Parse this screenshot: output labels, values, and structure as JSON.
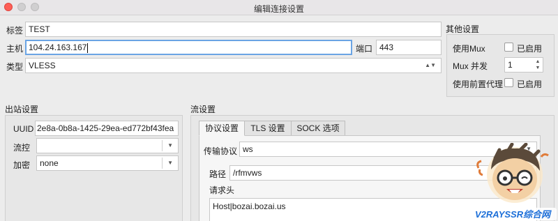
{
  "window": {
    "title": "编辑连接设置"
  },
  "basic": {
    "tag_label": "标签",
    "tag_value": "TEST",
    "host_label": "主机",
    "host_value": "104.24.163.167",
    "port_label": "端口",
    "port_value": "443",
    "type_label": "类型",
    "type_value": "VLESS"
  },
  "other": {
    "title": "其他设置",
    "mux_label": "使用Mux",
    "mux_enable": "已启用",
    "mux_enabled": false,
    "concurrency_label": "Mux 并发",
    "concurrency_value": "1",
    "proxy_label": "使用前置代理",
    "proxy_enable": "已启用",
    "proxy_enabled": false
  },
  "outbound": {
    "title": "出站设置",
    "uuid_label": "UUID",
    "uuid_value": "2e8a-0b8a-1425-29ea-ed772bf43fea",
    "flow_label": "流控",
    "flow_value": "",
    "encryption_label": "加密",
    "encryption_value": "none"
  },
  "stream": {
    "title": "流设置",
    "tabs": [
      {
        "label": "协议设置",
        "active": true
      },
      {
        "label": "TLS 设置",
        "active": false
      },
      {
        "label": "SOCK 选项",
        "active": false
      }
    ],
    "transport_label": "传输协议",
    "transport_value": "ws",
    "path_label": "路径",
    "path_value": "/rfmvws",
    "headers_label": "请求头",
    "headers_value": "Host|bozai.bozai.us"
  },
  "watermark": {
    "text": "V2RAYSSR综合网"
  },
  "colors": {
    "accent": "#6aa4e4",
    "close": "#fe5f57",
    "watermark_blue": "#1d6fd8",
    "watermark_red": "#e43a3a"
  }
}
